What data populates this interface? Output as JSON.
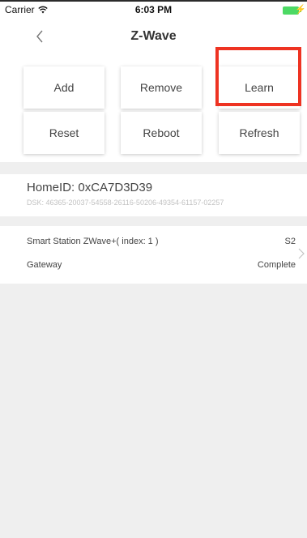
{
  "status_bar": {
    "carrier": "Carrier",
    "time": "6:03 PM"
  },
  "nav": {
    "title": "Z-Wave"
  },
  "actions": {
    "add": "Add",
    "remove": "Remove",
    "learn": "Learn",
    "reset": "Reset",
    "reboot": "Reboot",
    "refresh": "Refresh"
  },
  "home": {
    "home_id": "HomeID: 0xCA7D3D39",
    "dsk": "DSK: 46365-20037-54558-26116-50206-49354-61157-02257"
  },
  "device": {
    "name": "Smart Station ZWave+( index: 1 )",
    "security": "S2",
    "type": "Gateway",
    "status": "Complete"
  },
  "colors": {
    "highlight": "#ee3322",
    "battery": "#4cd964",
    "background": "#efefef"
  }
}
